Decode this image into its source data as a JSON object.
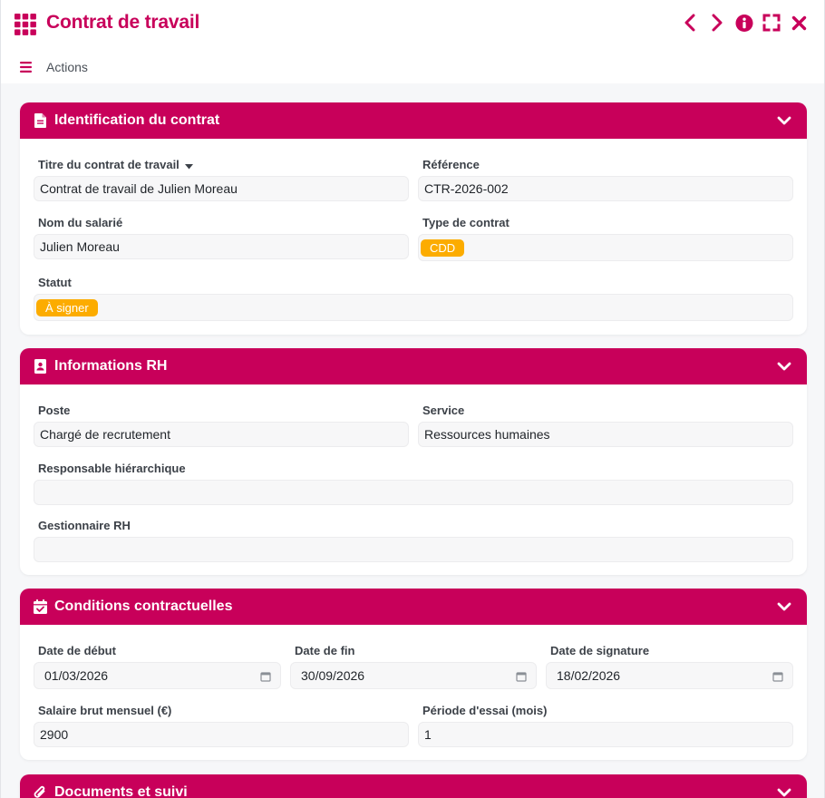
{
  "header": {
    "title": "Contrat de travail",
    "actions_label": "Actions",
    "brand_color": "#c8005a",
    "icons": [
      "apps-grid-icon",
      "chevron-left-icon",
      "chevron-right-icon",
      "info-icon",
      "fullscreen-icon",
      "close-icon"
    ]
  },
  "sections": {
    "identification": {
      "title": "Identification du contrat",
      "icon": "document-icon",
      "fields": {
        "titre": {
          "label": "Titre du contrat de travail",
          "value": "Contrat de travail de Julien Moreau"
        },
        "reference": {
          "label": "Référence",
          "value": "CTR-2026-002"
        },
        "salarie": {
          "label": "Nom du salarié",
          "value": "Julien Moreau"
        },
        "type": {
          "label": "Type de contrat",
          "value": "CDD"
        },
        "statut": {
          "label": "Statut",
          "value": "À signer"
        }
      }
    },
    "rh": {
      "title": "Informations RH",
      "icon": "id-badge-icon",
      "fields": {
        "poste": {
          "label": "Poste",
          "value": "Chargé de recrutement"
        },
        "service": {
          "label": "Service",
          "value": "Ressources humaines"
        },
        "responsable": {
          "label": "Responsable hiérarchique",
          "value": ""
        },
        "gestionnaire": {
          "label": "Gestionnaire RH",
          "value": ""
        }
      }
    },
    "conditions": {
      "title": "Conditions contractuelles",
      "icon": "calendar-check-icon",
      "fields": {
        "debut": {
          "label": "Date de début",
          "value": "01/03/2026"
        },
        "fin": {
          "label": "Date de fin",
          "value": "30/09/2026"
        },
        "signature": {
          "label": "Date de signature",
          "value": "18/02/2026"
        },
        "salaire": {
          "label": "Salaire brut mensuel (€)",
          "value": "2900"
        },
        "essai": {
          "label": "Période d'essai (mois)",
          "value": "1"
        }
      }
    },
    "documents": {
      "title": "Documents et suivi",
      "icon": "paperclip-icon"
    }
  },
  "colors": {
    "badge": "#fcac00",
    "field_bg": "#f7f7f8"
  }
}
